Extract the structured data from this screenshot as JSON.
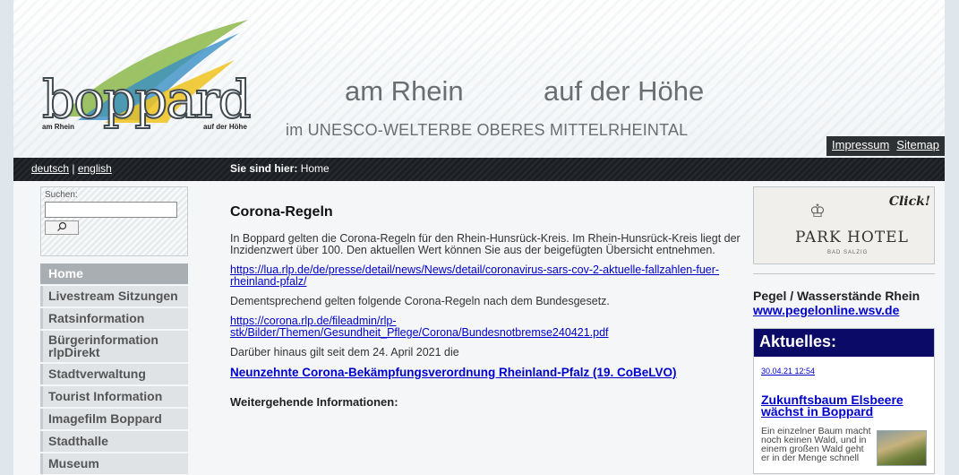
{
  "header": {
    "logo_text": "boppard",
    "logo_sub_left": "am Rhein",
    "logo_sub_right": "auf der Höhe",
    "tagline_left": "am Rhein",
    "tagline_right": "auf der Höhe",
    "subtitle": "im UNESCO-WELTERBE OBERES MITTELRHEINTAL",
    "links": [
      "Impressum",
      "Sitemap"
    ]
  },
  "navbar": {
    "lang_de": "deutsch",
    "lang_sep": " | ",
    "lang_en": "english",
    "breadcrumb_label": "Sie sind hier:",
    "breadcrumb_value": "Home"
  },
  "search": {
    "label": "Suchen:",
    "button_icon": "search-icon"
  },
  "menu": [
    "Home",
    "Livestream Sitzungen",
    "Ratsinformation",
    "Bürgerinformation rlpDirekt",
    "Stadtverwaltung",
    "Tourist Information",
    "Imagefilm Boppard",
    "Stadthalle",
    "Museum"
  ],
  "content": {
    "title": "Corona-Regeln",
    "p1": "In Boppard gelten die Corona-Regeln für den Rhein-Hunsrück-Kreis. Im Rhein-Hunsrück-Kreis liegt der Inzidenzwert über 100. Den aktuellen Wert können Sie aus der beigefügten Übersicht entnehmen.",
    "link1": "https://lua.rlp.de/de/presse/detail/news/News/detail/coronavirus-sars-cov-2-aktuelle-fallzahlen-fuer-rheinland-pfalz/",
    "p2": "Dementsprechend gelten folgende Corona-Regeln nach dem Bundesgesetz.",
    "link2": "https://corona.rlp.de/fileadmin/rlp-stk/Bilder/Themen/Gesundheit_Pflege/Corona/Bundesnotbremse240421.pdf",
    "p3": "Darüber hinaus gilt seit dem 24. April 2021 die",
    "link3": "Neunzehnte Corona-Bekämpfungsverordnung Rheinland-Pfalz (19. CoBeLVO)",
    "h2": "Weitergehende Informationen:"
  },
  "right": {
    "ad_click": "Click!",
    "ad_name": "PARK HOTEL",
    "ad_sub": "BAD SALZIG",
    "pegel_title": "Pegel / Wasserstände Rhein",
    "pegel_link": "www.pegelonline.wsv.de",
    "news_head": "Aktuelles:",
    "news_date": "30.04.21 12:54",
    "news_title": "Zukunftsbaum Elsbeere wächst in Boppard",
    "news_text": "Ein einzelner Baum macht noch keinen Wald, und in einem großen Wald geht er in der Menge schnell"
  },
  "colors": {
    "navbar": "#1b1e22",
    "news_head": "#0b0b67",
    "link": "#0000cc"
  }
}
